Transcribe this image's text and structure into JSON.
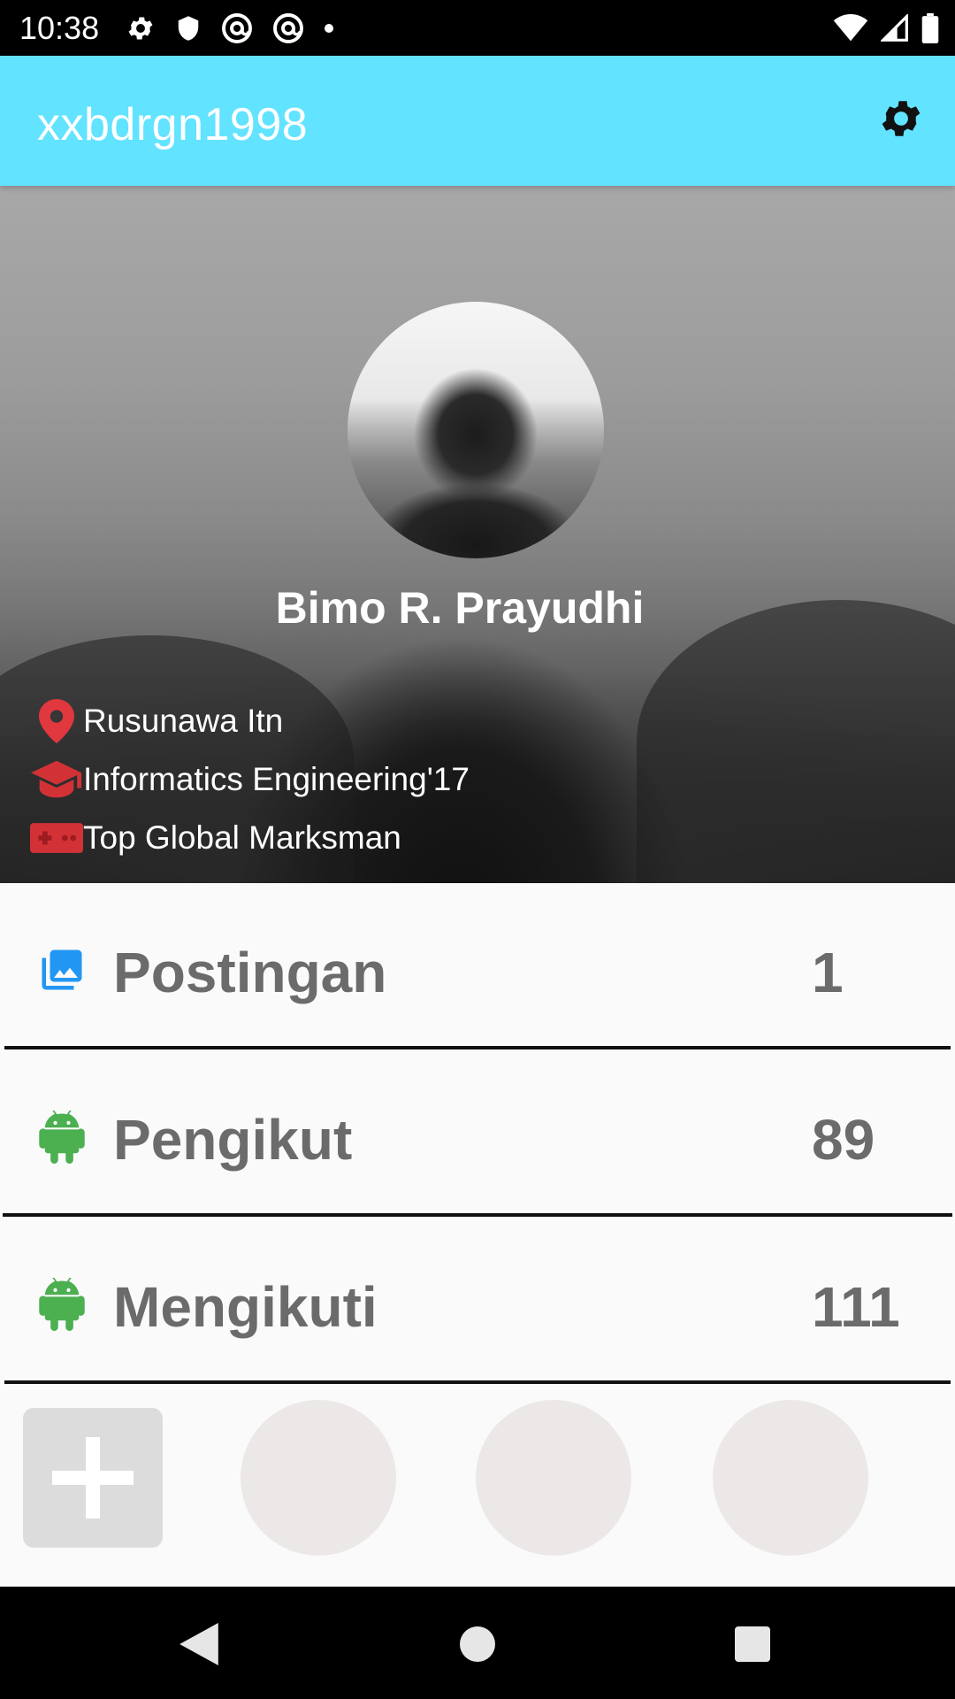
{
  "status_bar": {
    "time": "10:38",
    "icons_left": [
      "gear-icon",
      "shield-icon",
      "at-sign-icon",
      "at-sign-icon",
      "dot-icon"
    ],
    "icons_right": [
      "wifi-icon",
      "cell-signal-icon",
      "battery-icon"
    ]
  },
  "app_bar": {
    "title": "xxbdrgn1998",
    "settings_icon": "gear-icon",
    "color": "#62e3ff"
  },
  "profile": {
    "name": "Bimo R. Prayudhi",
    "info": [
      {
        "icon": "location-pin-icon",
        "text": "Rusunawa Itn"
      },
      {
        "icon": "graduation-cap-icon",
        "text": "Informatics Engineering'17"
      },
      {
        "icon": "gamepad-icon",
        "text": "Top Global Marksman"
      }
    ]
  },
  "stats": [
    {
      "icon": "image-icon",
      "label": "Postingan",
      "value": "1"
    },
    {
      "icon": "android-icon",
      "label": "Pengikut",
      "value": "89"
    },
    {
      "icon": "android-icon",
      "label": "Mengikuti",
      "value": "111"
    }
  ],
  "thumbnails": {
    "add_icon": "plus-icon",
    "count": 3
  },
  "nav_bar": {
    "buttons": [
      "back-icon",
      "home-icon",
      "recents-icon"
    ]
  },
  "colors": {
    "accent_red": "#e0383e",
    "android_green": "#4caf50",
    "image_blue": "#2196f3",
    "stat_text": "#6b6b6b"
  }
}
